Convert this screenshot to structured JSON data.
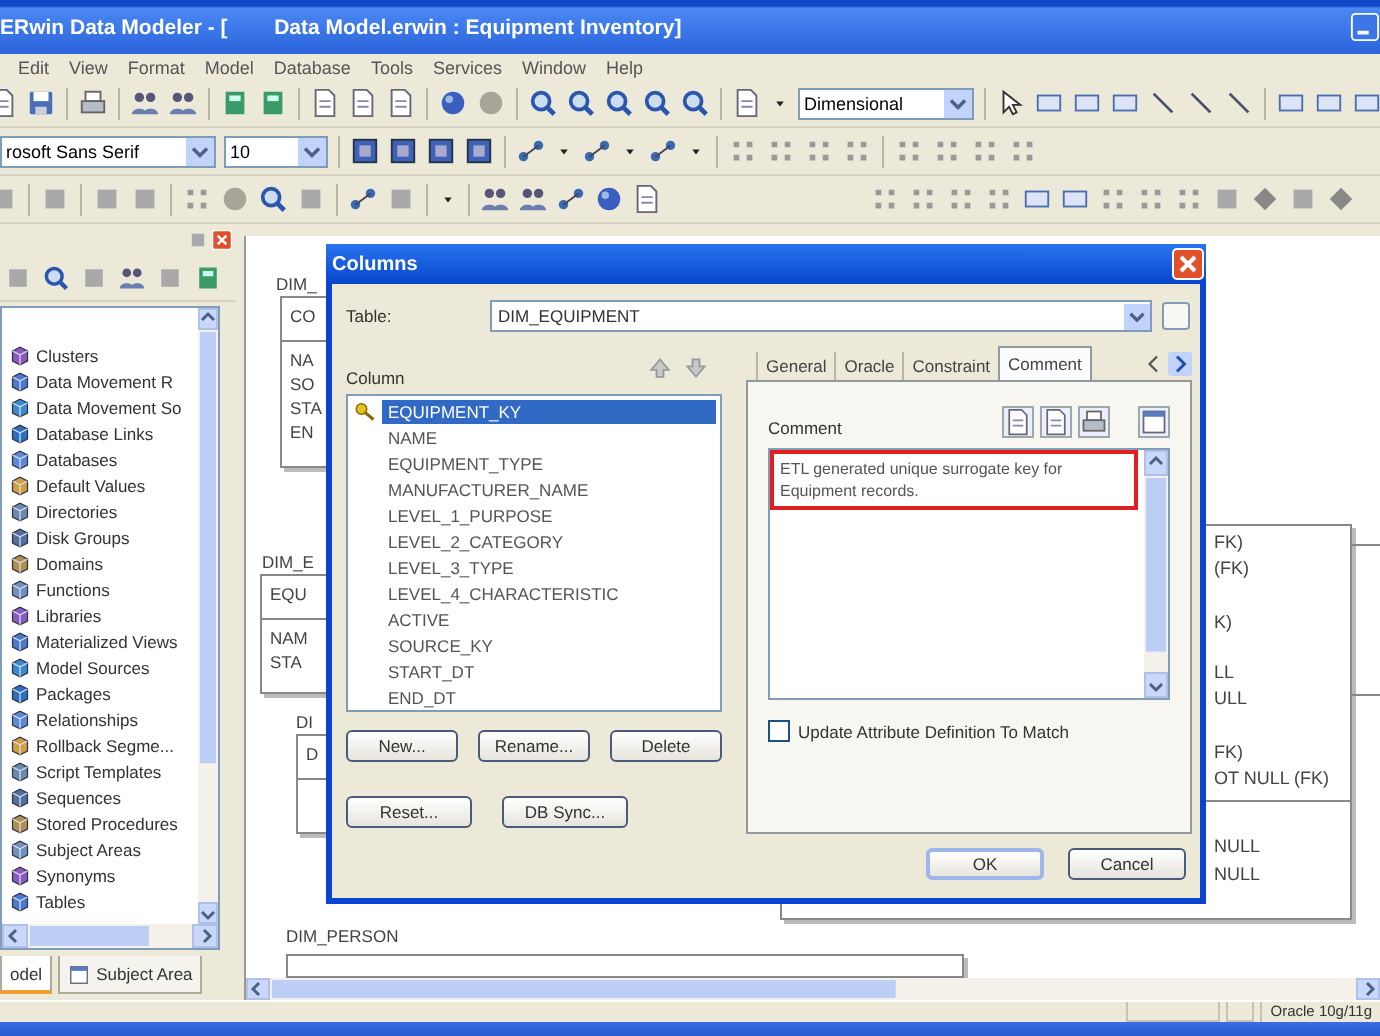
{
  "window": {
    "title": "ERwin Data Modeler - [        Data Model.erwin : Equipment Inventory]"
  },
  "menu": [
    "Edit",
    "View",
    "Format",
    "Model",
    "Database",
    "Tools",
    "Services",
    "Window",
    "Help"
  ],
  "toolbar": {
    "font": "rosoft Sans Serif",
    "font_size": "10",
    "display_level": "Dimensional"
  },
  "model_explorer": {
    "items": [
      "Clusters",
      "Data Movement R",
      "Data Movement So",
      "Database Links",
      "Databases",
      "Default Values",
      "Directories",
      "Disk Groups",
      "Domains",
      "Functions",
      "Libraries",
      "Materialized Views",
      "Model Sources",
      "Packages",
      "Relationships",
      "Rollback Segme...",
      "Script Templates",
      "Sequences",
      "Stored Procedures",
      "Subject Areas",
      "Synonyms",
      "Tables"
    ],
    "tabs": [
      {
        "label": "odel",
        "selected": true
      },
      {
        "label": "Subject Area",
        "selected": false
      }
    ]
  },
  "canvas": {
    "entities": [
      {
        "name": "DIM_",
        "key_columns": [
          "CO"
        ],
        "columns": [
          "NA",
          "SO",
          "STA",
          "EN"
        ]
      },
      {
        "name": "DIM_E",
        "key_columns": [
          "EQU"
        ],
        "columns": [
          "NAM",
          "STA"
        ]
      },
      {
        "name": "DI",
        "key_columns": [
          "D"
        ]
      },
      {
        "name": "DIM_PERSON"
      }
    ],
    "partial_entity": {
      "lines": [
        "FK)",
        "(FK)",
        "K)",
        "LL",
        "ULL",
        "FK)",
        "OT NULL (FK)",
        "NULL",
        "NULL"
      ]
    }
  },
  "dialog": {
    "title": "Columns",
    "table_label": "Table:",
    "table": "DIM_EQUIPMENT",
    "column_label": "Column",
    "columns": [
      {
        "name": "EQUIPMENT_KY",
        "key": true,
        "selected": true
      },
      {
        "name": "NAME",
        "key": false,
        "selected": false
      },
      {
        "name": "EQUIPMENT_TYPE",
        "key": false,
        "selected": false
      },
      {
        "name": "MANUFACTURER_NAME",
        "key": false,
        "selected": false
      },
      {
        "name": "LEVEL_1_PURPOSE",
        "key": false,
        "selected": false
      },
      {
        "name": "LEVEL_2_CATEGORY",
        "key": false,
        "selected": false
      },
      {
        "name": "LEVEL_3_TYPE",
        "key": false,
        "selected": false
      },
      {
        "name": "LEVEL_4_CHARACTERISTIC",
        "key": false,
        "selected": false
      },
      {
        "name": "ACTIVE",
        "key": false,
        "selected": false
      },
      {
        "name": "SOURCE_KY",
        "key": false,
        "selected": false
      },
      {
        "name": "START_DT",
        "key": false,
        "selected": false
      },
      {
        "name": "END_DT",
        "key": false,
        "selected": false
      }
    ],
    "list_buttons": [
      "New...",
      "Rename...",
      "Delete"
    ],
    "sync_buttons": [
      "Reset...",
      "DB Sync..."
    ],
    "tabs": [
      {
        "label": "General",
        "selected": false
      },
      {
        "label": "Oracle",
        "selected": false
      },
      {
        "label": "Constraint",
        "selected": false
      },
      {
        "label": "Comment",
        "selected": true
      }
    ],
    "comment_label": "Comment",
    "comment": "ETL generated unique surrogate key for Equipment records.",
    "update_definition": {
      "label": "Update Attribute Definition To Match",
      "checked": false
    },
    "buttons": [
      "OK",
      "Cancel"
    ]
  },
  "status_bar": {
    "database": "Oracle 10g/11g"
  }
}
